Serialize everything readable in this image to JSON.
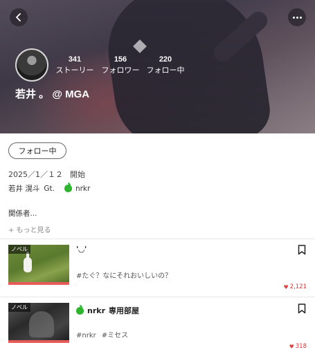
{
  "header": {
    "stats": [
      {
        "value": "341",
        "label": "ストーリー"
      },
      {
        "value": "156",
        "label": "フォロワー"
      },
      {
        "value": "220",
        "label": "フォロー中"
      }
    ],
    "user_name": "若井 。 @ MGA"
  },
  "profile": {
    "follow_button": "フォロー中",
    "start_date": "2025／1／１２",
    "start_label": "開始",
    "bio_name": "若井 滉斗",
    "bio_role": "Gt.",
    "bio_tag": "nrkr",
    "bio_text": "関係者...",
    "show_more": "+ もっと見る"
  },
  "stories": [
    {
      "badge": "ノベル",
      "title": "'◡'",
      "tags": [
        "#たぐ？なにそれおいしいの？"
      ],
      "likes": "2,121"
    },
    {
      "badge": "ノベル",
      "title_tag": "nrkr",
      "title": "専用部屋",
      "tags": [
        "#nrkr",
        "#ミセス"
      ],
      "likes": "318"
    }
  ],
  "icons": {
    "back": "chevron-left-icon",
    "more": "more-horizontal-icon",
    "bookmark": "bookmark-icon",
    "heart": "heart-icon",
    "apple": "green-apple-emoji"
  },
  "colors": {
    "accent_red": "#e65a5a",
    "likes_red": "#d33333",
    "apple_green": "#2db52d"
  }
}
